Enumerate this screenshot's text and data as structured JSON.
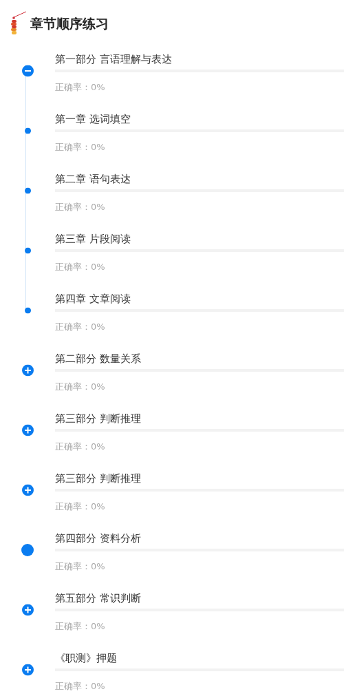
{
  "header": {
    "title": "章节顺序练习"
  },
  "parts": [
    {
      "title": "第一部分 言语理解与表达",
      "accuracy": "正确率：0%",
      "level": 0,
      "kind": "group",
      "expanded": true,
      "children": [
        {
          "title": "第一章 选词填空",
          "accuracy": "正确率：0%",
          "level": 0
        },
        {
          "title": "第二章 语句表达",
          "accuracy": "正确率：0%",
          "level": 0
        },
        {
          "title": "第三章 片段阅读",
          "accuracy": "正确率：0%",
          "level": 0
        },
        {
          "title": "第四章 文章阅读",
          "accuracy": "正确率：0%",
          "level": 0
        }
      ]
    },
    {
      "title": "第二部分 数量关系",
      "accuracy": "正确率：0%",
      "level": 0,
      "kind": "group",
      "expanded": false
    },
    {
      "title": "第三部分 判断推理",
      "accuracy": "正确率：0%",
      "level": 0,
      "kind": "group",
      "expanded": false
    },
    {
      "title": "第三部分 判断推理",
      "accuracy": "正确率：0%",
      "level": 0,
      "kind": "group",
      "expanded": false
    },
    {
      "title": "第四部分 资料分析",
      "accuracy": "正确率：0%",
      "level": 0,
      "kind": "leaf"
    },
    {
      "title": "第五部分 常识判断",
      "accuracy": "正确率：0%",
      "level": 0,
      "kind": "group",
      "expanded": false
    },
    {
      "title": "《职测》押题",
      "accuracy": "正确率：0%",
      "level": 0,
      "kind": "group",
      "expanded": false
    }
  ]
}
